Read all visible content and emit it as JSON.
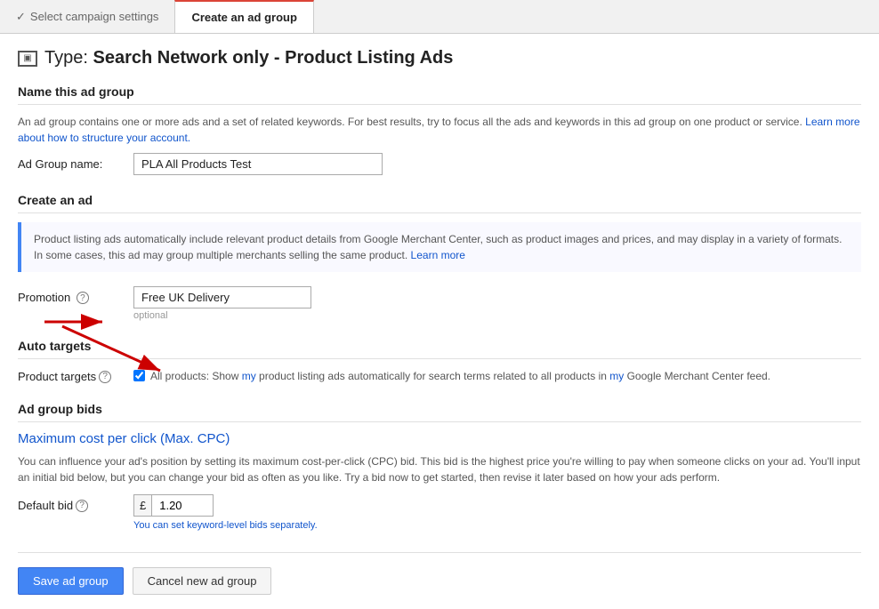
{
  "nav": {
    "tab1": {
      "label": "Select campaign settings",
      "state": "completed"
    },
    "tab2": {
      "label": "Create an ad group",
      "state": "active"
    }
  },
  "page": {
    "type_label": "Type:",
    "type_value": "Search Network only - Product Listing Ads",
    "icon_symbol": "▣"
  },
  "name_section": {
    "header": "Name this ad group",
    "description": "An ad group contains one or more ads and a set of related keywords. For best results, try to focus all the ads and keywords in this ad group on one product or service.",
    "learn_more_link": "Learn more about how to structure your account.",
    "label": "Ad Group name:",
    "placeholder": "",
    "value": "PLA All Products Test"
  },
  "create_ad_section": {
    "header": "Create an ad",
    "info_text": "Product listing ads automatically include relevant product details from Google Merchant Center, such as product images and prices, and may display in a variety of formats. In some cases, this ad may group multiple merchants selling the same product.",
    "learn_more": "Learn more",
    "promotion_label": "Promotion",
    "promotion_help": "?",
    "promotion_value": "Free UK Delivery",
    "optional_text": "optional"
  },
  "auto_targets_section": {
    "header": "Auto targets",
    "product_targets_label": "Product targets",
    "product_targets_help": "?",
    "checkbox_text": "All products: Show my product listing ads automatically for search terms related to all products in my Google Merchant Center feed."
  },
  "bids_section": {
    "header": "Ad group bids",
    "max_cpc_title": "Maximum cost per click (Max. CPC)",
    "description_part1": "You can influence your ad's position by setting its maximum cost-per-click (CPC) bid. This bid is the highest price you're willing to pay when someone clicks on your ad. You'll input an initial bid below, but you can change your bid as often as you like. Try a bid now to get started, then revise it later based on how your ads perform.",
    "default_bid_label": "Default bid",
    "default_bid_help": "?",
    "currency_symbol": "£",
    "default_bid_value": "1.20",
    "keyword_hint": "You can set keyword-level bids separately."
  },
  "buttons": {
    "save": "Save ad group",
    "cancel": "Cancel new ad group"
  }
}
